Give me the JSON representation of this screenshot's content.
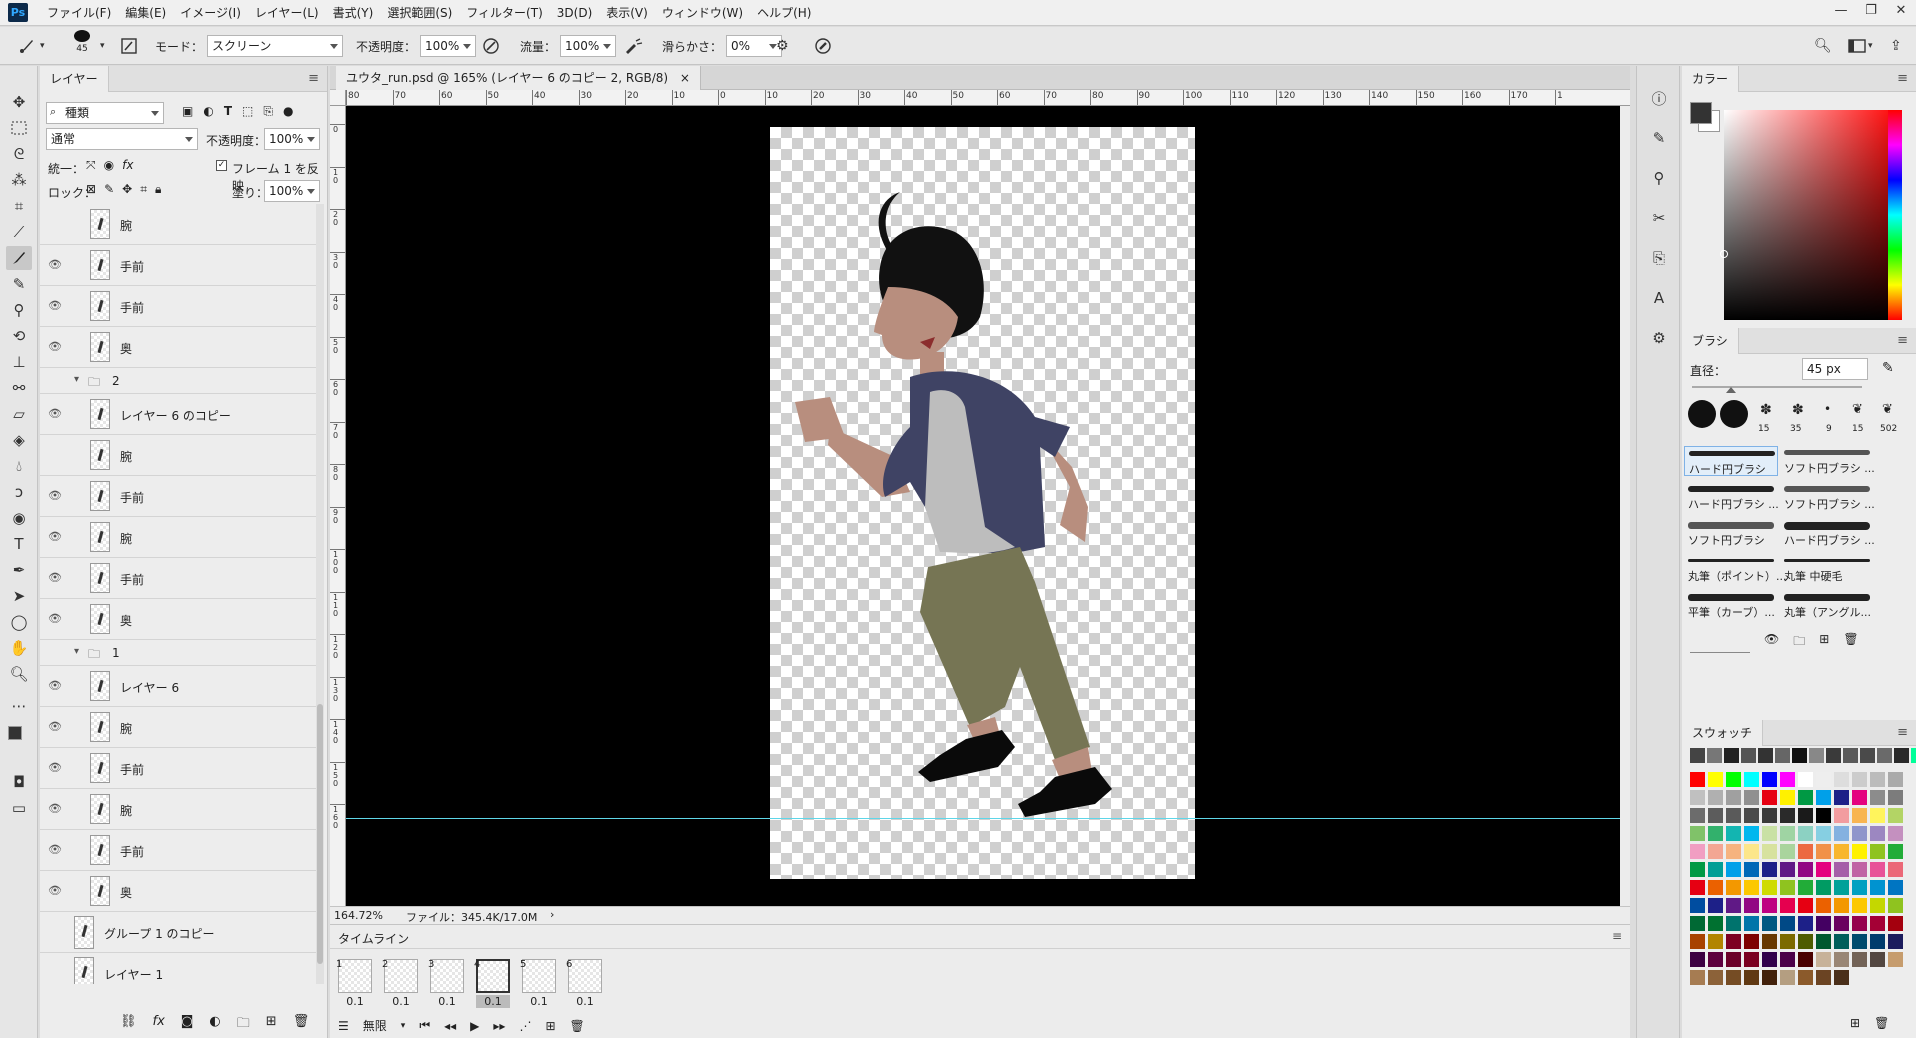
{
  "app": {
    "logo": "Ps"
  },
  "menubar": {
    "items": [
      "ファイル(F)",
      "編集(E)",
      "イメージ(I)",
      "レイヤー(L)",
      "書式(Y)",
      "選択範囲(S)",
      "フィルター(T)",
      "3D(D)",
      "表示(V)",
      "ウィンドウ(W)",
      "ヘルプ(H)"
    ],
    "window_controls": [
      "—",
      "❐",
      "✕"
    ]
  },
  "options": {
    "brush_size": "45",
    "mode_label": "モード：",
    "mode_value": "スクリーン",
    "opacity_label": "不透明度：",
    "opacity_value": "100%",
    "flow_label": "流量：",
    "flow_value": "100%",
    "smoothing_label": "滑らかさ：",
    "smoothing_value": "0%"
  },
  "layers_panel": {
    "tab": "レイヤー",
    "filter_kind": "種類",
    "blend_mode": "通常",
    "opacity_label": "不透明度：",
    "opacity_value": "100%",
    "unify_label": "統一：",
    "propagate_label": "フレーム 1 を反映",
    "lock_label": "ロック：",
    "fill_label": "塗り：",
    "fill_value": "100%",
    "rows": [
      {
        "name": "腕",
        "visible": false,
        "type": "layer"
      },
      {
        "name": "手前",
        "visible": true,
        "type": "layer"
      },
      {
        "name": "手前",
        "visible": true,
        "type": "layer"
      },
      {
        "name": "奥",
        "visible": true,
        "type": "layer"
      },
      {
        "name": "2",
        "visible": false,
        "type": "group"
      },
      {
        "name": "レイヤー 6 のコピー",
        "visible": true,
        "type": "layer"
      },
      {
        "name": "腕",
        "visible": false,
        "type": "layer"
      },
      {
        "name": "手前",
        "visible": true,
        "type": "layer"
      },
      {
        "name": "腕",
        "visible": true,
        "type": "layer"
      },
      {
        "name": "手前",
        "visible": true,
        "type": "layer"
      },
      {
        "name": "奥",
        "visible": true,
        "type": "layer"
      },
      {
        "name": "1",
        "visible": false,
        "type": "group"
      },
      {
        "name": "レイヤー 6",
        "visible": true,
        "type": "layer"
      },
      {
        "name": "腕",
        "visible": true,
        "type": "layer"
      },
      {
        "name": "手前",
        "visible": true,
        "type": "layer"
      },
      {
        "name": "腕",
        "visible": true,
        "type": "layer"
      },
      {
        "name": "手前",
        "visible": true,
        "type": "layer"
      },
      {
        "name": "奥",
        "visible": true,
        "type": "layer"
      },
      {
        "name": "グループ 1 のコピー",
        "visible": false,
        "type": "big"
      },
      {
        "name": "レイヤー 1",
        "visible": false,
        "type": "big"
      }
    ]
  },
  "document": {
    "tab_title": "ユウタ_run.psd @ 165% (レイヤー 6 のコピー 2, RGB/8)",
    "close": "×",
    "ruler_h": [
      "80",
      "70",
      "60",
      "50",
      "40",
      "30",
      "20",
      "10",
      "0",
      "10",
      "20",
      "30",
      "40",
      "50",
      "60",
      "70",
      "80",
      "90",
      "100",
      "110",
      "120",
      "130",
      "140",
      "150",
      "160",
      "170",
      "1"
    ],
    "ruler_v": [
      "0",
      "1 0",
      "2 0",
      "3 0",
      "4 0",
      "5 0",
      "6 0",
      "7 0",
      "8 0",
      "9 0",
      "1 0 0",
      "1 1 0",
      "1 2 0",
      "1 3 0",
      "1 4 0",
      "1 5 0",
      "1 6 0"
    ],
    "zoom": "164.72%",
    "file_info": "ファイル：345.4K/17.0M",
    "guide_color": "#5fd6e8"
  },
  "timeline": {
    "title": "タイムライン",
    "loop": "無限",
    "frames": [
      {
        "num": "1",
        "duration": "0.1",
        "selected": false
      },
      {
        "num": "2",
        "duration": "0.1",
        "selected": false
      },
      {
        "num": "3",
        "duration": "0.1",
        "selected": false
      },
      {
        "num": "4",
        "duration": "0.1",
        "selected": true
      },
      {
        "num": "5",
        "duration": "0.1",
        "selected": false
      },
      {
        "num": "6",
        "duration": "0.1",
        "selected": false
      }
    ]
  },
  "color_panel": {
    "title": "カラー"
  },
  "brush_panel": {
    "title": "ブラシ",
    "diameter_label": "直径：",
    "diameter_value": "45 px",
    "tip_sizes": [
      "15",
      "35",
      "9",
      "15",
      "502"
    ],
    "presets": [
      "ハード円ブラシ",
      "ソフト円ブラシ ...",
      "ハード円ブラシ ...",
      "ソフト円ブラシ ...",
      "ソフト円ブラシ",
      "ハード円ブラシ ...",
      "丸筆（ポイント）...",
      "丸筆 中硬毛",
      "平筆（カーブ）...",
      "丸筆（アングル..."
    ]
  },
  "swatches_panel": {
    "title": "スウォッチ",
    "colors": [
      "#444444",
      "#777777",
      "#222222",
      "#555555",
      "#333333",
      "#666666",
      "#111111",
      "#888888",
      "#3a3a3a",
      "#5a5a5a",
      "#4a4a4a",
      "#6a6a6a",
      "#2a2a2a",
      "#00ff99",
      "#ff0000",
      "#ffff00",
      "#00ff00",
      "#00ffff",
      "#0000ff",
      "#ff00ff",
      "#ffffff",
      "#eeeeee",
      "#dddddd",
      "#cccccc",
      "#bbbbbb",
      "#aaaaaa",
      "#c0c0c0",
      "#b0b0b0",
      "#a0a0a0",
      "#909090",
      "#e60012",
      "#fff100",
      "#009944",
      "#00a0e9",
      "#1d2088",
      "#e4007f",
      "#8c8c8c",
      "#7c7c7c",
      "#6c6c6c",
      "#5c5c5c",
      "#5a5a5a",
      "#4a4a4a",
      "#3a3a3a",
      "#2a2a2a",
      "#1a1a1a",
      "#000000",
      "#f29c9f",
      "#f8b551",
      "#fff45c",
      "#b3d465",
      "#80c269",
      "#32b16c",
      "#13b5b1",
      "#00b7ee",
      "#c9e1a5",
      "#9fd4a3",
      "#8cd1c2",
      "#86cfe2",
      "#84b1e0",
      "#8f96cb",
      "#9c87c1",
      "#c490bf",
      "#f19ec2",
      "#f3a693",
      "#f6b37f",
      "#fce68a",
      "#d7e29e",
      "#a9d49d",
      "#ec6941",
      "#f19149",
      "#f8b62d",
      "#fff100",
      "#8fc31f",
      "#22ac38",
      "#009944",
      "#009e96",
      "#00a0e9",
      "#0068b7",
      "#1d2088",
      "#601986",
      "#920783",
      "#e4007f",
      "#a55fa8",
      "#c063a4",
      "#e85298",
      "#eb6877",
      "#e60012",
      "#eb6100",
      "#f39800",
      "#fcc800",
      "#cfdb00",
      "#8fc31f",
      "#22ac38",
      "#009b63",
      "#00a199",
      "#00a0c1",
      "#0093d0",
      "#0075c2",
      "#004da0",
      "#1d2088",
      "#601986",
      "#920783",
      "#be0081",
      "#e5004f",
      "#e60012",
      "#eb6100",
      "#f39800",
      "#fcc800",
      "#c4d700",
      "#8fc31f",
      "#006934",
      "#007130",
      "#00736d",
      "#0075a9",
      "#005982",
      "#004986",
      "#1d2088",
      "#440062",
      "#6a005f",
      "#95004d",
      "#a40035",
      "#a4000e",
      "#a84200",
      "#b28500",
      "#7d0022",
      "#7e0000",
      "#683800",
      "#7c6a00",
      "#4f5c00",
      "#00582e",
      "#005e5a",
      "#004b6d",
      "#003c6d",
      "#1c1c5d",
      "#3c0042",
      "#5e003e",
      "#6b0028",
      "#7a0020",
      "#32004a",
      "#4b0049",
      "#4a0000",
      "#c7b299",
      "#998675",
      "#736357",
      "#534741",
      "#c69c6d",
      "#a67c52",
      "#8c6239",
      "#754c24",
      "#603913",
      "#42210b",
      "#b49e81",
      "#8b5a2b",
      "#6b4423",
      "#4a2f1a"
    ]
  }
}
